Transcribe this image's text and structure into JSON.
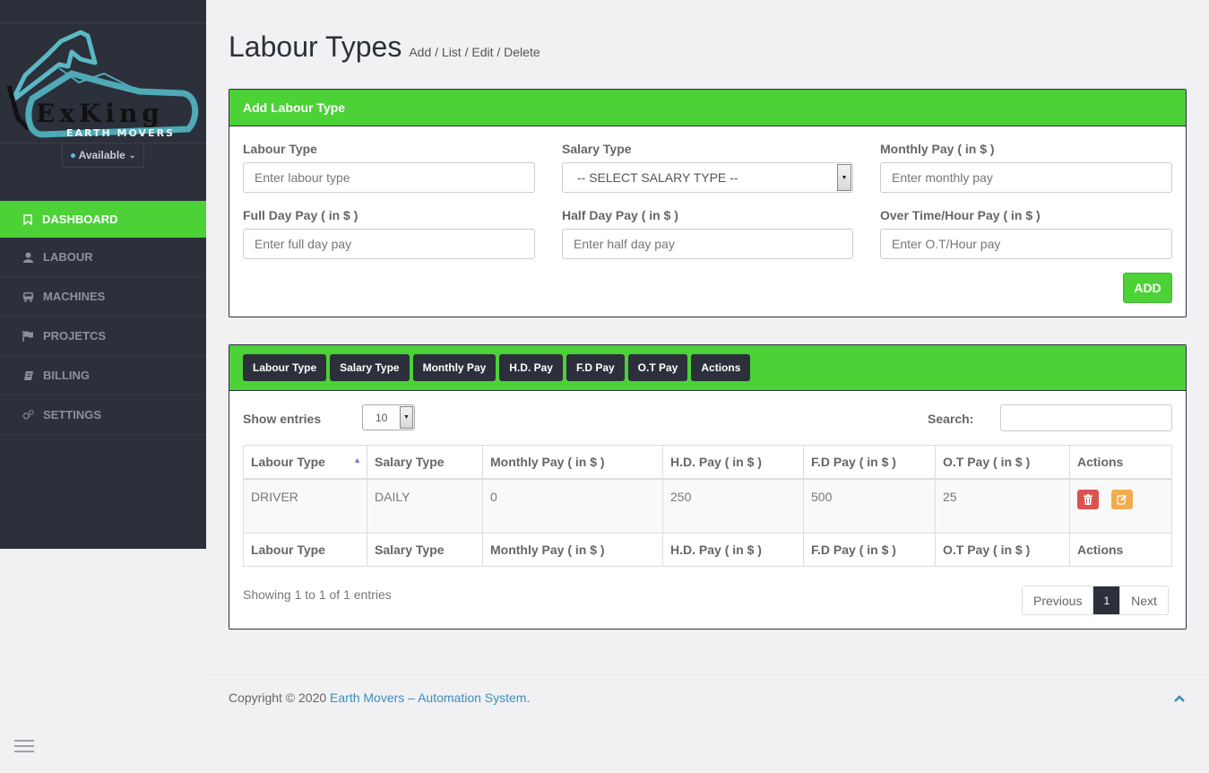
{
  "brand": {
    "logo_text": "ExKing",
    "logo_subtext": "EARTH MOVERS"
  },
  "sidebar": {
    "status": "Available",
    "items": [
      {
        "label": "DASHBOARD",
        "icon": "bookmark-icon"
      },
      {
        "label": "LABOUR",
        "icon": "user-icon"
      },
      {
        "label": "MACHINES",
        "icon": "bus-icon"
      },
      {
        "label": "PROJETCS",
        "icon": "flag-icon"
      },
      {
        "label": "BILLING",
        "icon": "book-icon"
      },
      {
        "label": "SETTINGS",
        "icon": "gears-icon"
      }
    ]
  },
  "header": {
    "title": "Labour Types",
    "crumbs": "Add / List / Edit / Delete"
  },
  "form": {
    "title": "Add Labour Type",
    "fields": {
      "labour_type": {
        "label": "Labour Type",
        "placeholder": "Enter labour type"
      },
      "salary_type": {
        "label": "Salary Type",
        "value": "-- SELECT SALARY TYPE --"
      },
      "monthly_pay": {
        "label": "Monthly Pay ( in $ )",
        "placeholder": "Enter monthly pay"
      },
      "full_day_pay": {
        "label": "Full Day Pay ( in $ )",
        "placeholder": "Enter full day pay"
      },
      "half_day_pay": {
        "label": "Half Day Pay ( in $ )",
        "placeholder": "Enter half day pay"
      },
      "ot_pay": {
        "label": "Over Time/Hour Pay ( in $ )",
        "placeholder": "Enter O.T/Hour pay"
      }
    },
    "add_label": "ADD"
  },
  "table_panel": {
    "column_buttons": [
      "Labour Type",
      "Salary Type",
      "Monthly Pay",
      "H.D. Pay",
      "F.D Pay",
      "O.T Pay",
      "Actions"
    ],
    "show_entries_label": "Show entries",
    "page_length": "10",
    "search_label": "Search:",
    "columns": [
      "Labour Type",
      "Salary Type",
      "Monthly Pay ( in $ )",
      "H.D. Pay ( in $ )",
      "F.D Pay ( in $ )",
      "O.T Pay ( in $ )",
      "Actions"
    ],
    "rows": [
      {
        "labour_type": "DRIVER",
        "salary_type": "DAILY",
        "monthly_pay": "0",
        "hd_pay": "250",
        "fd_pay": "500",
        "ot_pay": "25"
      }
    ],
    "showing": "Showing 1 to 1 of 1 entries",
    "pager": {
      "prev": "Previous",
      "current": "1",
      "next": "Next"
    }
  },
  "footer": {
    "prefix": "Copyright © 2020",
    "link": "Earth Movers – Automation System."
  },
  "colors": {
    "accent": "#4cd137",
    "sidebar": "#2b303b",
    "danger": "#d9534f",
    "warning": "#f0ad4e",
    "link": "#3c8dbc"
  }
}
